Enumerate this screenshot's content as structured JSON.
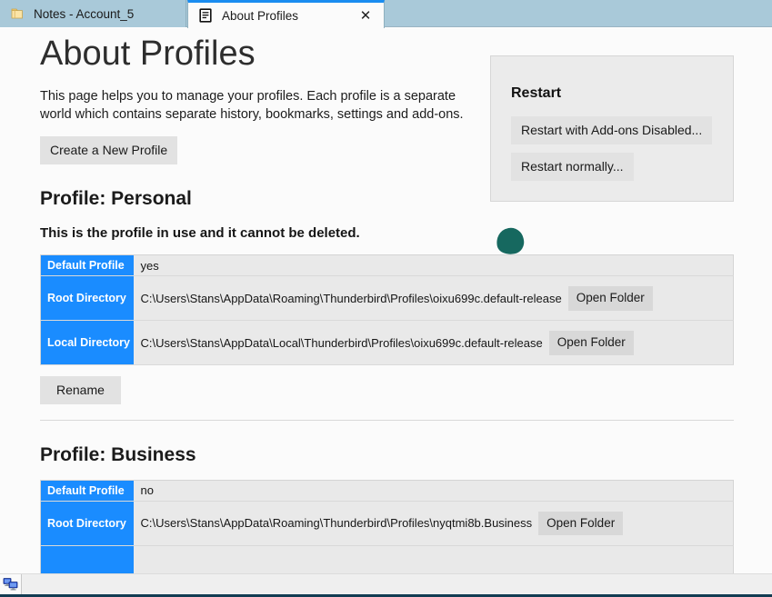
{
  "tabs": [
    {
      "label": "Notes - Account_5",
      "icon": "notes-icon",
      "active": false
    },
    {
      "label": "About Profiles",
      "icon": "document-icon",
      "active": true,
      "close_glyph": "✕"
    }
  ],
  "page": {
    "title": "About Profiles",
    "intro": "This page helps you to manage your profiles. Each profile is a separate world which contains separate history, bookmarks, settings and add-ons.",
    "create_profile_label": "Create a New Profile"
  },
  "restart_panel": {
    "heading": "Restart",
    "restart_addons_disabled_label": "Restart with Add-ons Disabled...",
    "restart_normally_label": "Restart normally..."
  },
  "profiles": [
    {
      "heading": "Profile: Personal",
      "note": "This is the profile in use and it cannot be deleted.",
      "rows": [
        {
          "label": "Default Profile",
          "value": "yes",
          "button": null
        },
        {
          "label": "Root Directory",
          "value": "C:\\Users\\Stans\\AppData\\Roaming\\Thunderbird\\Profiles\\oixu699c.default-release",
          "button": "Open Folder"
        },
        {
          "label": "Local Directory",
          "value": "C:\\Users\\Stans\\AppData\\Local\\Thunderbird\\Profiles\\oixu699c.default-release",
          "button": "Open Folder"
        }
      ],
      "rename_label": "Rename"
    },
    {
      "heading": "Profile: Business",
      "note": null,
      "rows": [
        {
          "label": "Default Profile",
          "value": "no",
          "button": null
        },
        {
          "label": "Root Directory",
          "value": "C:\\Users\\Stans\\AppData\\Roaming\\Thunderbird\\Profiles\\nyqtmi8b.Business",
          "button": "Open Folder"
        }
      ],
      "rename_label": null
    }
  ],
  "taskbar": {
    "item_icon": "network-computers-icon"
  },
  "colors": {
    "tabstrip_bg": "#a9c9d9",
    "active_tab_accent": "#1a8cf0",
    "table_header_blue": "#1a8cff",
    "table_cell_bg": "#e9e9e9",
    "button_bg": "#e2e2e2",
    "panel_bg": "#ebebeb",
    "cursor_blob": "#16685f",
    "taskbar_underline": "#123c52"
  }
}
